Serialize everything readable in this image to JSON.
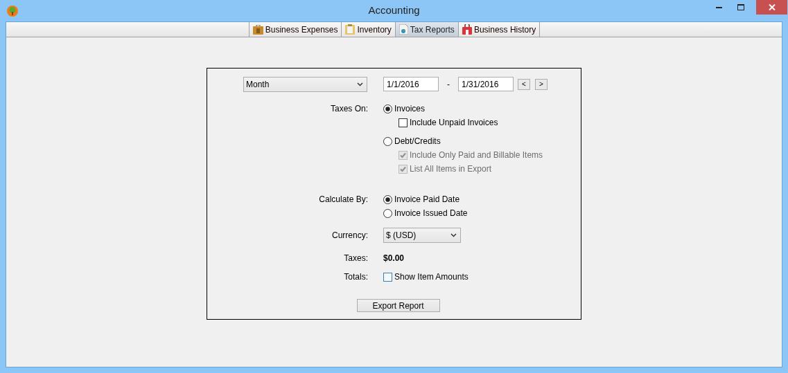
{
  "window": {
    "title": "Accounting"
  },
  "tabs": [
    {
      "label": "Business Expenses",
      "selected": false
    },
    {
      "label": "Inventory",
      "selected": false
    },
    {
      "label": "Tax Reports",
      "selected": true
    },
    {
      "label": "Business History",
      "selected": false
    }
  ],
  "period": {
    "value": "Month",
    "start_date": "1/1/2016",
    "separator": "-",
    "end_date": "1/31/2016",
    "prev": "<",
    "next": ">"
  },
  "taxes_on": {
    "label": "Taxes On:",
    "options": [
      {
        "label": "Invoices",
        "selected": true,
        "suboptions": [
          {
            "label": "Include Unpaid Invoices",
            "checked": false,
            "disabled": false
          }
        ]
      },
      {
        "label": "Debt/Credits",
        "selected": false,
        "suboptions": [
          {
            "label": "Include Only Paid and Billable Items",
            "checked": true,
            "disabled": true
          },
          {
            "label": "List All Items in Export",
            "checked": true,
            "disabled": true
          }
        ]
      }
    ]
  },
  "calculate_by": {
    "label": "Calculate By:",
    "options": [
      {
        "label": "Invoice Paid Date",
        "selected": true
      },
      {
        "label": "Invoice Issued Date",
        "selected": false
      }
    ]
  },
  "currency": {
    "label": "Currency:",
    "value": "$ (USD)"
  },
  "taxes": {
    "label": "Taxes:",
    "value": "$0.00"
  },
  "totals": {
    "label": "Totals:",
    "option": {
      "label": "Show Item Amounts",
      "checked": false
    }
  },
  "export_button": "Export Report"
}
